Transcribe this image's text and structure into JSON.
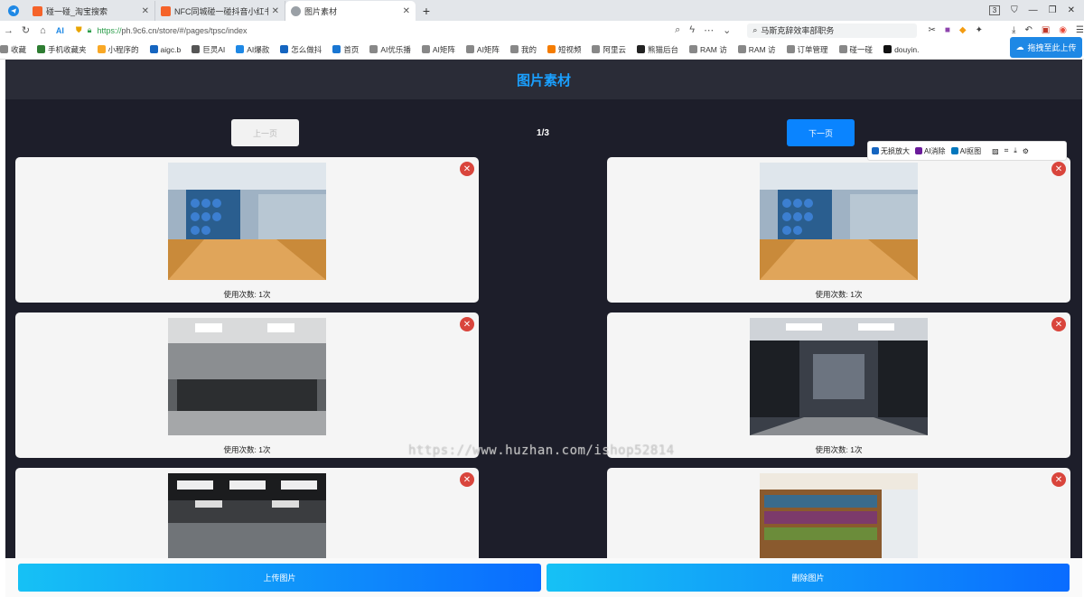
{
  "browser": {
    "tabs": [
      {
        "title": "碰一碰_淘宝搜索",
        "active": false
      },
      {
        "title": "NFC同城碰一碰抖音小红书视",
        "active": false
      },
      {
        "title": "图片素材",
        "active": true
      }
    ],
    "new_tab": "+",
    "url_scheme": "https://",
    "url_host": "ph.9c6.cn",
    "url_path": "/store/#/pages/tpsc/index",
    "search_box": "马斯克辞效率部职务",
    "window_count": "3",
    "bookmarks": [
      "收藏",
      "手机收藏夹",
      "小程序的",
      "aigc.b",
      "巨灵AI",
      "AI爆款",
      "怎么做抖",
      "首页",
      "AI优乐播",
      "AI矩阵",
      "AI矩阵",
      "我的",
      "短视频",
      "阿里云",
      "熊猫后台",
      "RAM 访",
      "RAM 访",
      "订单管理",
      "碰一碰",
      "douyin."
    ],
    "baidu_upload": "拖拽至此上传"
  },
  "page": {
    "title": "图片素材",
    "prev_label": "上一页",
    "page_indicator": "1/3",
    "next_label": "下一页",
    "cards": [
      {
        "caption": "使用次数: 1次",
        "image": "gym-studio-yoga-balls"
      },
      {
        "caption": "使用次数: 1次",
        "image": "gym-studio-yoga-balls"
      },
      {
        "caption": "使用次数: 1次",
        "image": "gym-weights-hall"
      },
      {
        "caption": "使用次数: 1次",
        "image": "gym-machines-hall"
      },
      {
        "caption": "",
        "image": "gym-ceiling-hall"
      },
      {
        "caption": "",
        "image": "gym-shelves-room"
      }
    ],
    "delete_glyph": "✕",
    "upload_label": "上传图片",
    "delete_label": "删除图片",
    "watermark": "https://www.huzhan.com/ishop52814"
  },
  "ai_toolbar": {
    "items": [
      "无损放大",
      "AI消除",
      "AI抠图"
    ]
  }
}
